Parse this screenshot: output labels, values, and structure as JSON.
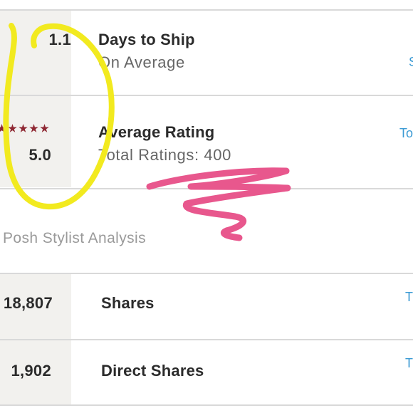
{
  "stats": [
    {
      "value": "1.1",
      "title": "Days to Ship",
      "subtitle": "On Average",
      "edge_link": "S"
    },
    {
      "value": "5.0",
      "title": "Average Rating",
      "subtitle": "Total Ratings: 400",
      "edge_link": "To",
      "stars": 5
    }
  ],
  "analysis": {
    "heading": "Posh Stylist Analysis",
    "rows": [
      {
        "value": "18,807",
        "label": "Shares",
        "edge_link": "T"
      },
      {
        "value": "1,902",
        "label": "Direct Shares",
        "edge_link": "T"
      }
    ]
  },
  "annotations": {
    "circle_color": "#f2ea1f",
    "scribble_color": "#e8578d"
  }
}
